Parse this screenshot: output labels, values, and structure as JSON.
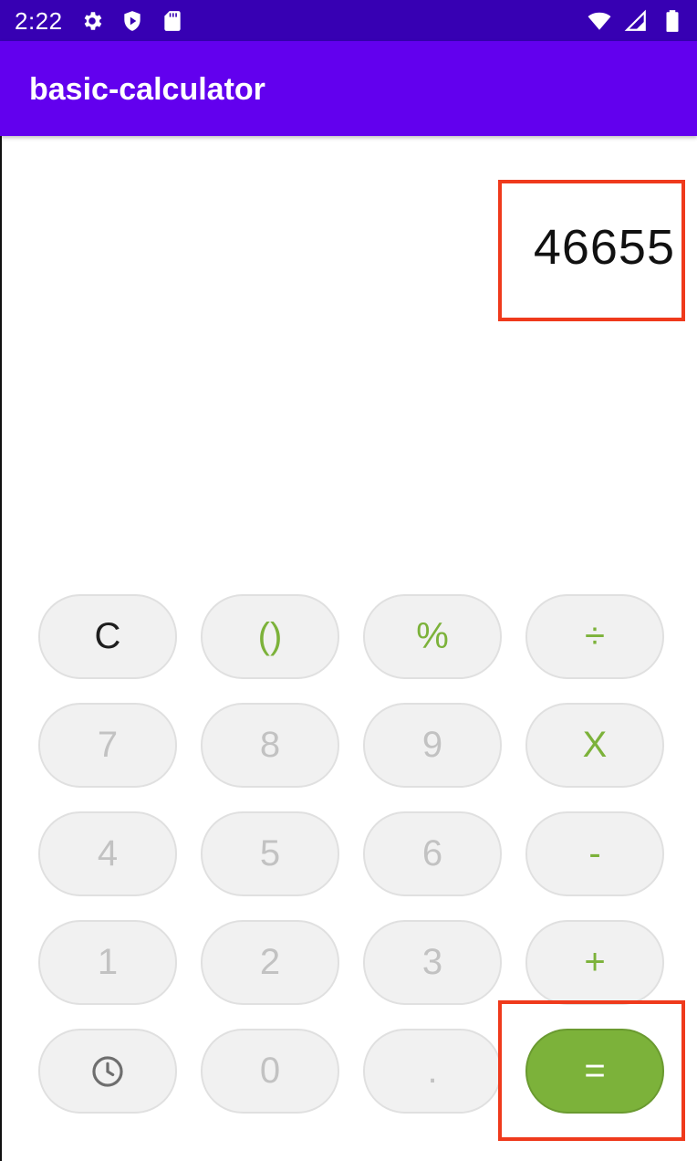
{
  "status_bar": {
    "time": "2:22",
    "left_icons": [
      "gear-icon",
      "shield-icon",
      "sd-card-icon"
    ],
    "right_icons": [
      "wifi-icon",
      "signal-icon",
      "battery-icon"
    ]
  },
  "app_bar": {
    "title": "basic-calculator"
  },
  "display": {
    "value": "46655"
  },
  "keys": {
    "clear": "C",
    "parentheses": "()",
    "percent": "%",
    "divide": "÷",
    "seven": "7",
    "eight": "8",
    "nine": "9",
    "multiply": "X",
    "four": "4",
    "five": "5",
    "six": "6",
    "minus": "-",
    "one": "1",
    "two": "2",
    "three": "3",
    "plus": "+",
    "history_icon": "clock-icon",
    "zero": "0",
    "decimal": ".",
    "equals": "="
  },
  "colors": {
    "status_bar": "#3700b3",
    "app_bar": "#6200ee",
    "accent_green": "#7cb23a",
    "highlight_red": "#ef3a1c"
  }
}
